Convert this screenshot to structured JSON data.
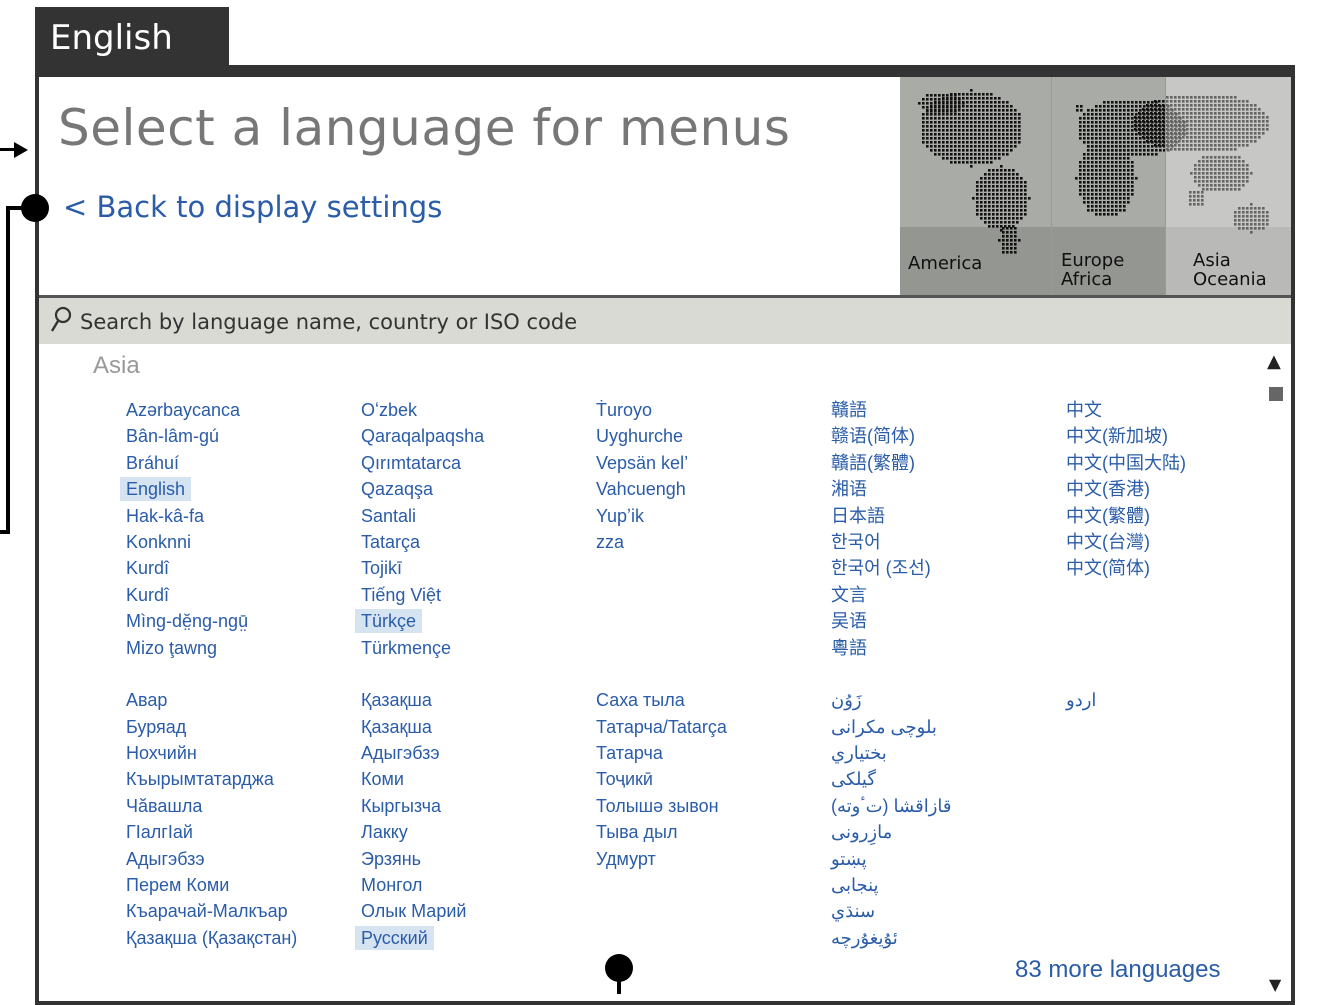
{
  "tab": {
    "label": "English"
  },
  "header": {
    "title": "Select a language for menus",
    "back_link": "< Back to display settings"
  },
  "map": {
    "regions": [
      {
        "label": "America"
      },
      {
        "label": "Europe\nAfrica"
      },
      {
        "label": "Asia\nOceania"
      }
    ],
    "selected_region": "Asia\nOceania"
  },
  "search": {
    "placeholder": "Search by language name, country or ISO code"
  },
  "region_title": "Asia",
  "columns": [
    [
      "Azərbaycanca",
      "Bân-lâm-gú",
      "Bráhuí",
      "English",
      "Hak-kâ-fa",
      "Konknni",
      "Kurdî",
      "Kurdî",
      "Mìng-dĕ̤ng-ngṳ̄",
      "Mizo ţawng",
      "",
      "Авар",
      "Буряад",
      "Нохчийн",
      "Къырымтатарджа",
      "Чӑвашла",
      "ГIалгIай",
      "Адыгэбзэ",
      "Перем Коми",
      "Къарачай-Малкъар",
      "Қазақша (Қазақстан)"
    ],
    [
      "Oʻzbek",
      "Qaraqalpaqsha",
      "Qırımtatarca",
      "Qazaqşa",
      "Santali",
      "Tatarça",
      "Tojikī",
      "Tiếng Việt",
      "Türkçe",
      "Türkmençe",
      "",
      "Қазақша",
      "Қазақша",
      "Адыгэбзэ",
      "Коми",
      "Кыргызча",
      "Лакку",
      "Эрзянь",
      "Монгол",
      "Олык Марий",
      "Русский"
    ],
    [
      "Ṫuroyo",
      "Uyghurche",
      "Vepsän kel’",
      "Vahcuengh",
      "Yupʼik",
      "zza",
      "",
      "",
      "",
      "",
      "",
      "Саха тыла",
      "Татарча/Tatarça",
      "Татарча",
      "Тоҷикӣ",
      "Толышә зывон",
      "Тыва дыл",
      "Удмурт",
      "",
      "",
      ""
    ],
    [
      "贛語",
      "赣语(简体)",
      "贛語(繁體)",
      "湘语",
      "日本語",
      "한국어",
      "한국어 (조선)",
      "文言",
      "吴语",
      "粵語",
      "",
      "زَوُن",
      "بلوچی مکرانی",
      "بختياري",
      "گیلکی",
      "قازاقشا (تٴوتە)",
      "مازِرونی",
      "پښتو",
      "پنجابی",
      "سنڌي",
      "ئۇيغۇرچە"
    ],
    [
      "中文",
      "中文(新加坡)",
      "中文(中国大陆)",
      "中文(香港)",
      "中文(繁體)",
      "中文(台灣)",
      "中文(简体)",
      "",
      "",
      "",
      "",
      "اردو",
      "",
      "",
      "",
      "",
      "",
      "",
      "",
      "",
      ""
    ]
  ],
  "highlighted": [
    "English",
    "Türkçe",
    "Русский"
  ],
  "more_link": "83 more languages",
  "icons": {
    "search": "search-icon",
    "scroll_up": "triangle-up-icon",
    "scroll_down": "triangle-down-icon"
  }
}
